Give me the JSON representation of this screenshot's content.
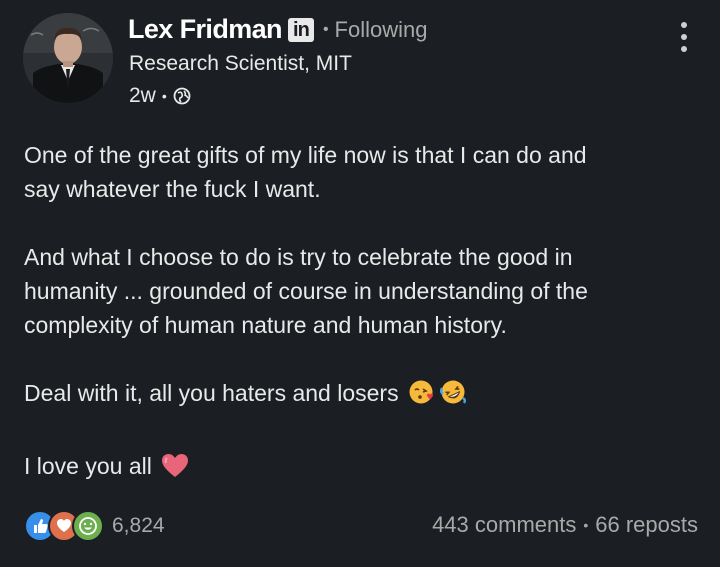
{
  "author": {
    "name": "Lex Fridman",
    "linkedin_badge": "in",
    "connection_separator": "•",
    "follow_status": "Following",
    "headline": "Research Scientist, MIT",
    "time_ago": "2w",
    "meta_separator": "•",
    "visibility_icon": "globe-icon"
  },
  "post": {
    "paragraphs": [
      [
        "One of the great gifts of my life now is that I can do and",
        "say whatever the fuck I want."
      ],
      [
        "And what I choose to do is try to celebrate the good in",
        "humanity ... grounded of course in understanding of the",
        "complexity of human nature and human history."
      ],
      [
        "Deal with it, all you haters and losers"
      ],
      [
        "I love you all"
      ]
    ],
    "emojis": [
      "kissing-heart-emoji",
      "rolling-laughing-emoji",
      "heart-emoji"
    ]
  },
  "social": {
    "reaction_icons": [
      "like-icon",
      "love-icon",
      "funny-icon"
    ],
    "reaction_count": "6,824",
    "comments": "443 comments",
    "stats_separator": "•",
    "reposts": "66 reposts"
  },
  "colors": {
    "background": "#1b1f23",
    "text": "#e9e9e9",
    "muted": "#a9a9a9",
    "like": "#378fe9",
    "love": "#df704d",
    "heart": "#e8657a"
  }
}
